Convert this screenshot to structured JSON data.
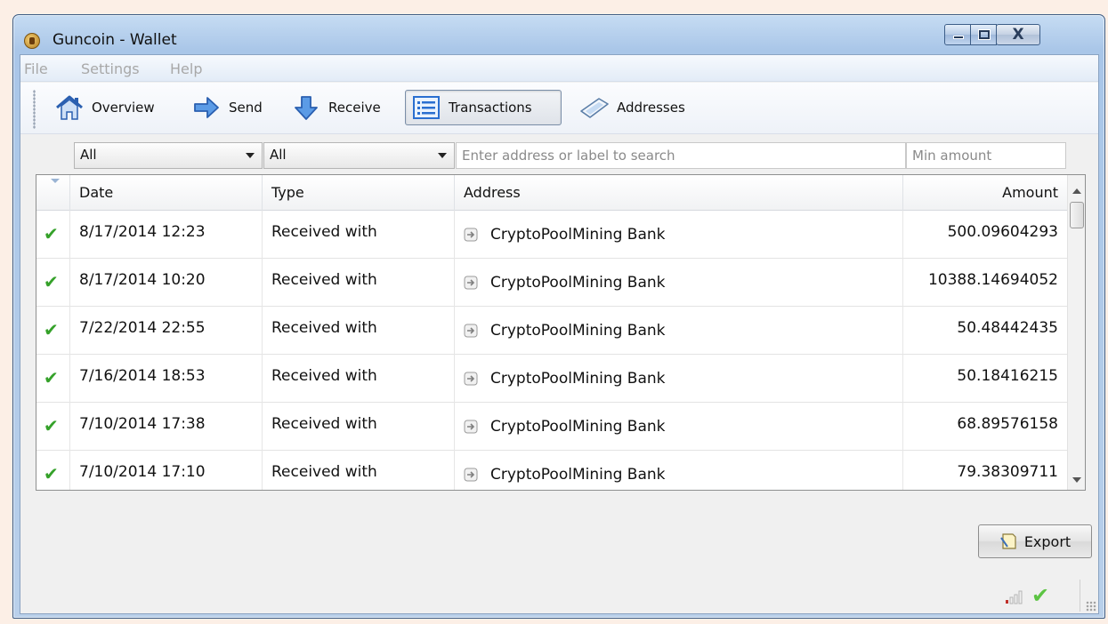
{
  "window": {
    "title": "Guncoin - Wallet",
    "close_glyph": "X"
  },
  "menu": [
    "File",
    "Settings",
    "Help"
  ],
  "toolbar": {
    "overview": "Overview",
    "send": "Send",
    "receive": "Receive",
    "transactions": "Transactions",
    "addresses": "Addresses"
  },
  "filters": {
    "date_filter": "All",
    "type_filter": "All",
    "search_placeholder": "Enter address or label to search",
    "min_amount_placeholder": "Min amount"
  },
  "table": {
    "columns": {
      "date": "Date",
      "type": "Type",
      "address": "Address",
      "amount": "Amount"
    },
    "rows": [
      {
        "status": "confirmed",
        "date": "8/17/2014 12:23",
        "type": "Received with",
        "address": "CryptoPoolMining Bank",
        "amount": "500.09604293"
      },
      {
        "status": "confirmed",
        "date": "8/17/2014 10:20",
        "type": "Received with",
        "address": "CryptoPoolMining Bank",
        "amount": "10388.14694052"
      },
      {
        "status": "confirmed",
        "date": "7/22/2014 22:55",
        "type": "Received with",
        "address": "CryptoPoolMining Bank",
        "amount": "50.48442435"
      },
      {
        "status": "confirmed",
        "date": "7/16/2014 18:53",
        "type": "Received with",
        "address": "CryptoPoolMining Bank",
        "amount": "50.18416215"
      },
      {
        "status": "confirmed",
        "date": "7/10/2014 17:38",
        "type": "Received with",
        "address": "CryptoPoolMining Bank",
        "amount": "68.89576158"
      },
      {
        "status": "confirmed",
        "date": "7/10/2014 17:10",
        "type": "Received with",
        "address": "CryptoPoolMining Bank",
        "amount": "79.38309711"
      }
    ]
  },
  "export_label": "Export",
  "status": {
    "sync": "synced"
  },
  "colors": {
    "check": "#35a12a",
    "accent": "#3a6fc4"
  }
}
